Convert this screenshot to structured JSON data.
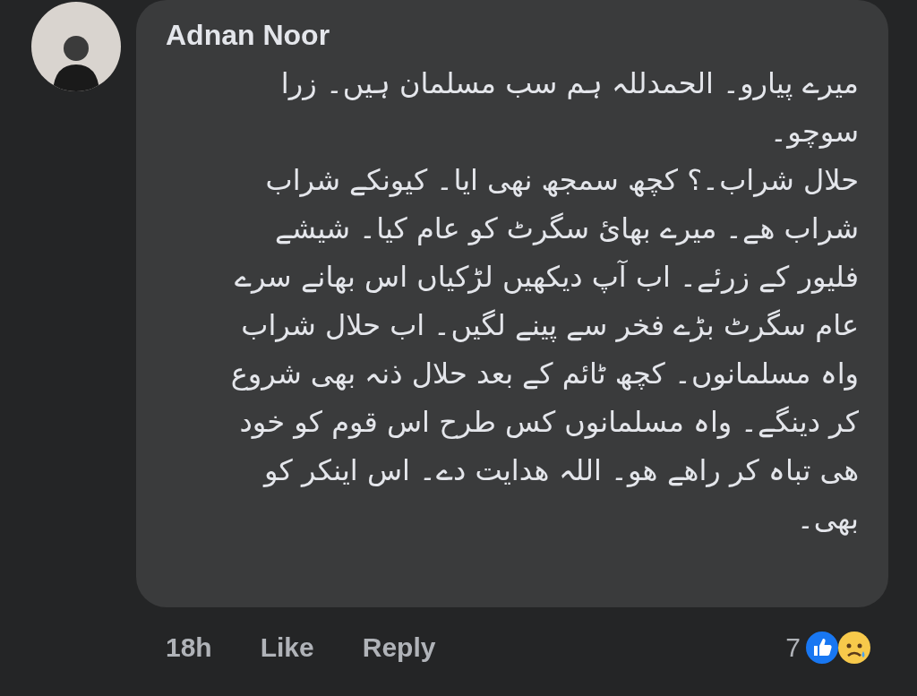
{
  "comment": {
    "author": "Adnan Noor",
    "lines": [
      "میرے پیارو۔ الحمدللہ ہم سب مسلمان ہیں۔ زرا",
      "سوچو۔",
      "حلال شراب۔؟ کچھ سمجھ نھی ایا۔ کیونکے شراب",
      "شراب ھے۔ میرے بھائ سگرٹ کو عام کیا۔ شیشے",
      "فلیور کے زرئے۔ اب آپ دیکھیں لڑکیاں اس بھانے سرے",
      "عام سگرٹ بڑے فخر سے پینے لگیں۔ اب حلال شراب",
      "واہ مسلمانوں۔ کچھ ٹائم کے بعد حلال ذنہ بھی شروع",
      "کر دینگے۔ واہ مسلمانوں کس طرح اس قوم کو خود",
      "ھی تباہ کر راھے ھو۔ اللہ ھدایت دے۔ اس اینکر کو",
      "بھی۔"
    ],
    "time": "18h",
    "like": "Like",
    "reply": "Reply",
    "reaction_count": "7"
  }
}
